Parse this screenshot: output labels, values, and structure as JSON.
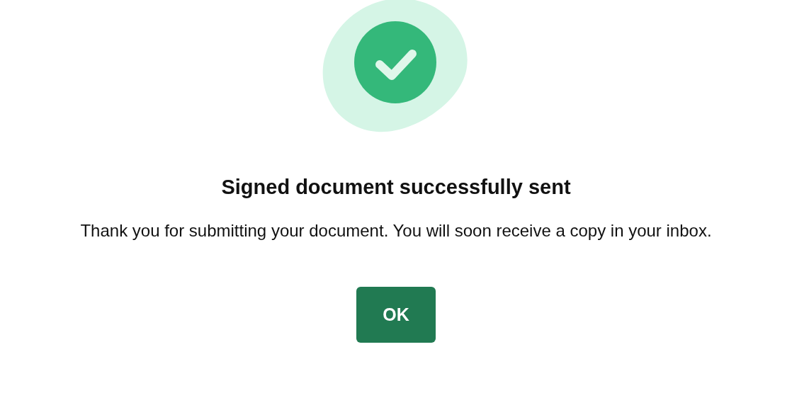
{
  "dialog": {
    "title": "Signed document successfully sent",
    "message": "Thank you for submitting your document. You will soon receive a copy in your inbox.",
    "buttons": [
      {
        "label": "OK"
      }
    ]
  }
}
